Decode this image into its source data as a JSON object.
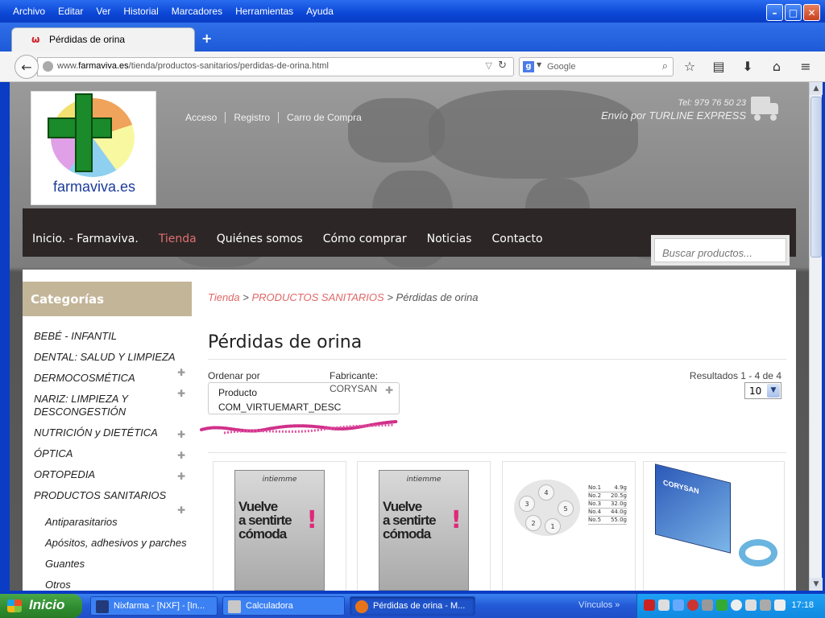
{
  "window": {
    "menu": [
      "Archivo",
      "Editar",
      "Ver",
      "Historial",
      "Marcadores",
      "Herramientas",
      "Ayuda"
    ],
    "tab_title": "Pérdidas de orina",
    "url_prefix": "www.",
    "url_domain": "farmaviva.es",
    "url_path": "/tienda/productos-sanitarios/perdidas-de-orina.html",
    "search_placeholder": "Google"
  },
  "site": {
    "logo_text": "farmaviva.es",
    "top_links": [
      "Acceso",
      "Registro",
      "Carro de Compra"
    ],
    "phone": "Tel: 979 76 50 23",
    "shipping": "Envío por TURLINE EXPRESS",
    "nav": [
      "Inicio. - Farmaviva.",
      "Tienda",
      "Quiénes somos",
      "Cómo comprar",
      "Noticias",
      "Contacto"
    ],
    "nav_active": "Tienda",
    "search_placeholder": "Buscar productos..."
  },
  "sidebar": {
    "heading": "Categorías",
    "categories": [
      {
        "label": "BEBÉ - INFANTIL",
        "expandable": false
      },
      {
        "label": "DENTAL: SALUD Y LIMPIEZA",
        "expandable": false
      },
      {
        "label": "DERMOCOSMÉTICA",
        "expandable": true
      },
      {
        "label": "NARIZ: LIMPIEZA Y",
        "label2": "DESCONGESTIÓN",
        "expandable": true
      },
      {
        "label": "NUTRICIÓN y DIETÉTICA",
        "expandable": true
      },
      {
        "label": "ÓPTICA",
        "expandable": true
      },
      {
        "label": "ORTOPEDIA",
        "expandable": true
      },
      {
        "label": "PRODUCTOS SANITARIOS",
        "expandable": true
      }
    ],
    "subcategories": [
      "Antiparasitarios",
      "Apósitos, adhesivos y parches",
      "Guantes",
      "Otros"
    ]
  },
  "main": {
    "breadcrumb": [
      "Tienda",
      ">",
      "PRODUCTOS SANITARIOS",
      ">",
      "Pérdidas de orina"
    ],
    "title": "Pérdidas de orina",
    "order_label": "Ordenar por",
    "order_value_1": "Producto",
    "order_value_2": "COM_VIRTUEMART_DESC",
    "manufacturer_label": "Fabricante:",
    "manufacturer_value": "CORYSAN",
    "results": "Resultados 1 - 4 de 4",
    "limit_value": "10"
  },
  "products": [
    {
      "brand": "intiemme",
      "slogan_1": "Vuelve",
      "slogan_2": "a sentirte",
      "slogan_3": "cómoda",
      "excl": "!"
    },
    {
      "brand": "intiemme",
      "slogan_1": "Vuelve",
      "slogan_2": "a sentirte",
      "slogan_3": "cómoda",
      "excl": "!"
    },
    {
      "balls": [
        "1",
        "2",
        "3",
        "4",
        "5"
      ],
      "table": [
        [
          "No.1",
          "4.9g"
        ],
        [
          "No.2",
          "20.5g"
        ],
        [
          "No.3",
          "32.0g"
        ],
        [
          "No.4",
          "44.0g"
        ],
        [
          "No.5",
          "55.0g"
        ]
      ]
    },
    {
      "box_label": "CORYSAN"
    }
  ],
  "taskbar": {
    "start": "Inicio",
    "tasks": [
      "Nixfarma - [NXF] - [In...",
      "Calculadora",
      "Pérdidas de orina - M..."
    ],
    "links": "Vínculos",
    "clock": "17:18"
  },
  "colors": {
    "nav_bg": "#2c2626",
    "accent_link": "#e06767",
    "sidebar_head": "#c3b598",
    "xp_blue": "#0a3cc4"
  }
}
